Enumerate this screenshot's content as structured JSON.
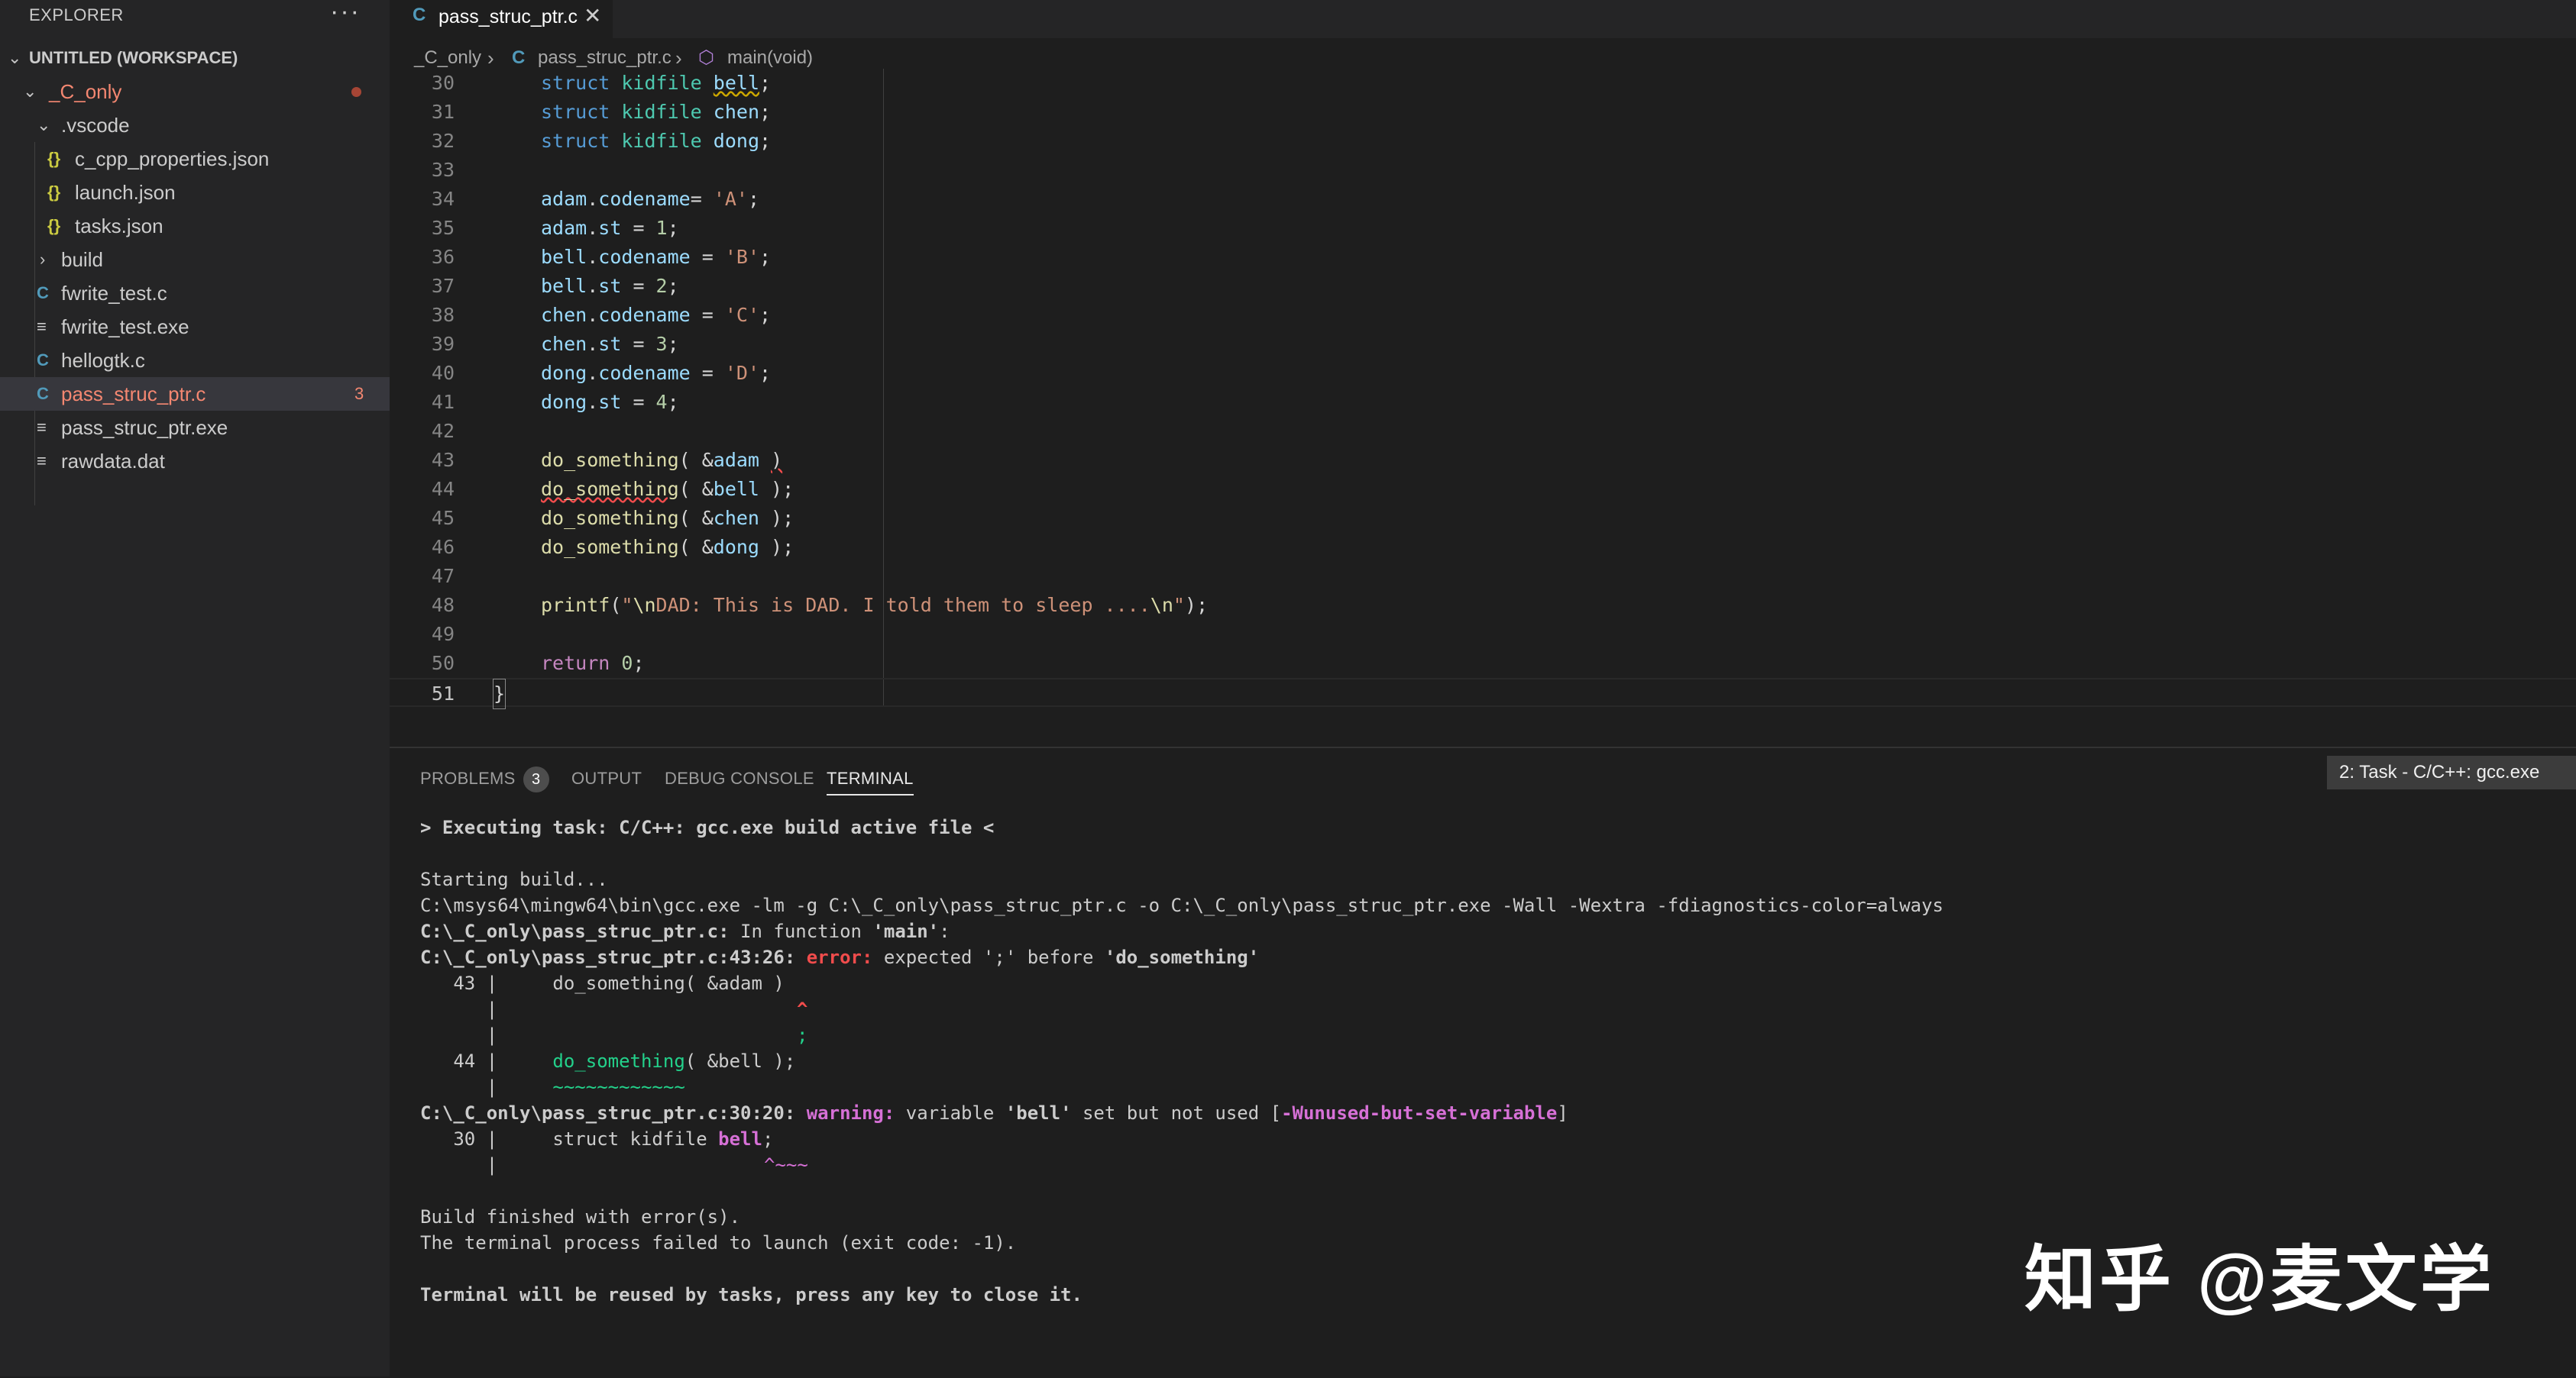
{
  "sidebar": {
    "title": "EXPLORER",
    "more": "···",
    "workspace": "UNTITLED (WORKSPACE)",
    "folder": "_C_only",
    "items": [
      {
        "label": ".vscode",
        "type": "folder"
      },
      {
        "label": "c_cpp_properties.json",
        "type": "json"
      },
      {
        "label": "launch.json",
        "type": "json"
      },
      {
        "label": "tasks.json",
        "type": "json"
      },
      {
        "label": "build",
        "type": "folder"
      },
      {
        "label": "fwrite_test.c",
        "type": "c"
      },
      {
        "label": "fwrite_test.exe",
        "type": "exe"
      },
      {
        "label": "hellogtk.c",
        "type": "c"
      },
      {
        "label": "pass_struc_ptr.c",
        "type": "c",
        "problems": "3"
      },
      {
        "label": "pass_struc_ptr.exe",
        "type": "exe"
      },
      {
        "label": "rawdata.dat",
        "type": "dat"
      }
    ],
    "json_icon": "{}",
    "c_icon": "C",
    "file_icon": "≡"
  },
  "tab": {
    "icon": "C",
    "label": "pass_struc_ptr.c",
    "close": "✕"
  },
  "breadcrumb": {
    "folder": "_C_only",
    "file": "pass_struc_ptr.c",
    "symbol": "main(void)"
  },
  "line_numbers": [
    "30",
    "31",
    "32",
    "33",
    "34",
    "35",
    "36",
    "37",
    "38",
    "39",
    "40",
    "41",
    "42",
    "43",
    "44",
    "45",
    "46",
    "47",
    "48",
    "49",
    "50",
    "51"
  ],
  "panel": {
    "tabs": {
      "problems": "PROBLEMS",
      "problems_count": "3",
      "output": "OUTPUT",
      "debug": "DEBUG CONSOLE",
      "terminal": "TERMINAL"
    },
    "terminal_select": "2: Task - C/C++: gcc.exe"
  },
  "terminal": {
    "exec": "> Executing task: C/C++: gcc.exe build active file <",
    "starting": "Starting build...",
    "cmd": "C:\\msys64\\mingw64\\bin\\gcc.exe -lm -g C:\\_C_only\\pass_struc_ptr.c -o C:\\_C_only\\pass_struc_ptr.exe -Wall -Wextra -fdiagnostics-color=always",
    "infunc_file": "C:\\_C_only\\pass_struc_ptr.c:",
    "infunc_text": " In function ",
    "infunc_name": "'main'",
    "infunc_end": ":",
    "err_loc": "C:\\_C_only\\pass_struc_ptr.c:43:26: ",
    "err_word": "error:",
    "err_text": " expected ';' before ",
    "err_name": "'do_something'",
    "l43": "   43 |     do_something( &adam )",
    "l43_caret_bar": "      |",
    "l43_caret": "^",
    "l43_semi_bar": "      |",
    "l43_semi": ";",
    "l44_pre": "   44 |     ",
    "l44_fn": "do_something",
    "l44_rest": "( &bell );",
    "l44_bar": "      |     ",
    "l44_tilde": "~~~~~~~~~~~~",
    "warn_loc": "C:\\_C_only\\pass_struc_ptr.c:30:20: ",
    "warn_word": "warning:",
    "warn_text": " variable ",
    "warn_name": "'bell'",
    "warn_text2": " set but not used [",
    "warn_flag": "-Wunused-but-set-variable",
    "warn_end": "]",
    "l30_pre": "   30 |     struct kidfile ",
    "l30_var": "bell",
    "l30_end": ";",
    "l30_bar": "      |",
    "l30_caret": "^~~~",
    "finished": "Build finished with error(s).",
    "failed": "The terminal process failed to launch (exit code: -1).",
    "reuse": "Terminal will be reused by tasks, press any key to close it."
  },
  "watermark": "知乎 @麦文学"
}
